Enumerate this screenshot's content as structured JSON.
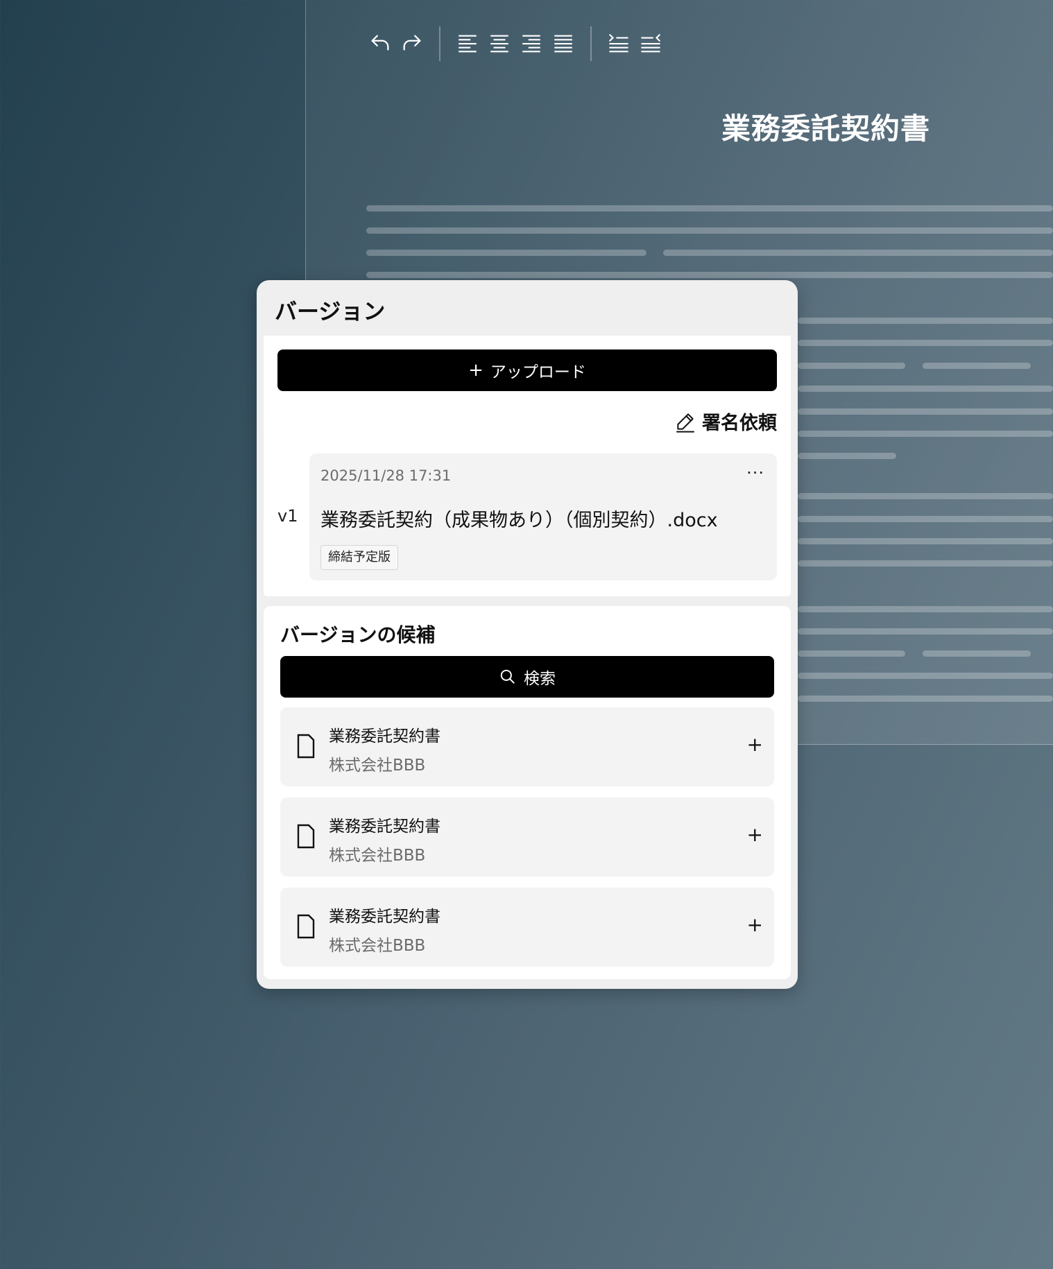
{
  "toolbar": {
    "icons": [
      "undo-icon",
      "redo-icon",
      "align-left-icon",
      "align-center-icon",
      "align-right-icon",
      "align-justify-icon",
      "indent-icon",
      "outdent-icon"
    ]
  },
  "document": {
    "title": "業務委託契約書"
  },
  "version_panel": {
    "title": "バージョン",
    "upload_button": {
      "icon": "plus",
      "label": "アップロード"
    },
    "sign_request": {
      "icon": "pen-icon",
      "label": "署名依頼"
    },
    "versions": [
      {
        "label": "v1",
        "timestamp": "2025/11/28 17:31",
        "more": "···",
        "filename": "業務委託契約（成果物あり）（個別契約）.docx",
        "badge": "締結予定版"
      }
    ]
  },
  "candidates": {
    "title": "バージョンの候補",
    "search_button": {
      "icon": "search-icon",
      "label": "検索"
    },
    "items": [
      {
        "name": "業務委託契約書",
        "company": "株式会社BBB",
        "add": "+"
      },
      {
        "name": "業務委託契約書",
        "company": "株式会社BBB",
        "add": "+"
      },
      {
        "name": "業務委託契約書",
        "company": "株式会社BBB",
        "add": "+"
      }
    ]
  },
  "colors": {
    "background_start": "#23404f",
    "background_end": "#637a86",
    "panel": "#efefef",
    "button": "#000000",
    "card": "#ffffff"
  }
}
